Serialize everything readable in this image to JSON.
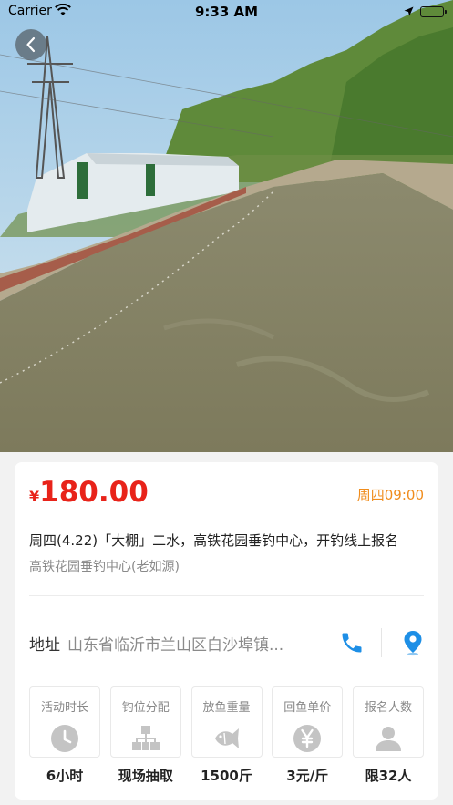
{
  "status_bar": {
    "carrier": "Carrier",
    "time": "9:33 AM"
  },
  "event": {
    "price_symbol": "¥",
    "price": "180.00",
    "start_time": "周四09:00",
    "title": "周四(4.22)「大棚」二水，高铁花园垂钓中心，开钓线上报名",
    "venue": "高铁花园垂钓中心(老如源)"
  },
  "address": {
    "label": "地址",
    "value": "山东省临沂市兰山区白沙埠镇..."
  },
  "stats": [
    {
      "label": "活动时长",
      "value": "6小时",
      "icon": "clock-icon"
    },
    {
      "label": "钓位分配",
      "value": "现场抽取",
      "icon": "seat-allocation-icon"
    },
    {
      "label": "放鱼重量",
      "value": "1500斤",
      "icon": "fish-icon"
    },
    {
      "label": "回鱼单价",
      "value": "3元/斤",
      "icon": "yen-icon"
    },
    {
      "label": "报名人数",
      "value": "限32人",
      "icon": "person-icon"
    }
  ],
  "colors": {
    "price": "#e8231a",
    "time_tag": "#f08c1c",
    "accent_blue": "#1e8fe6",
    "icon_gray": "#c4c4c4"
  }
}
